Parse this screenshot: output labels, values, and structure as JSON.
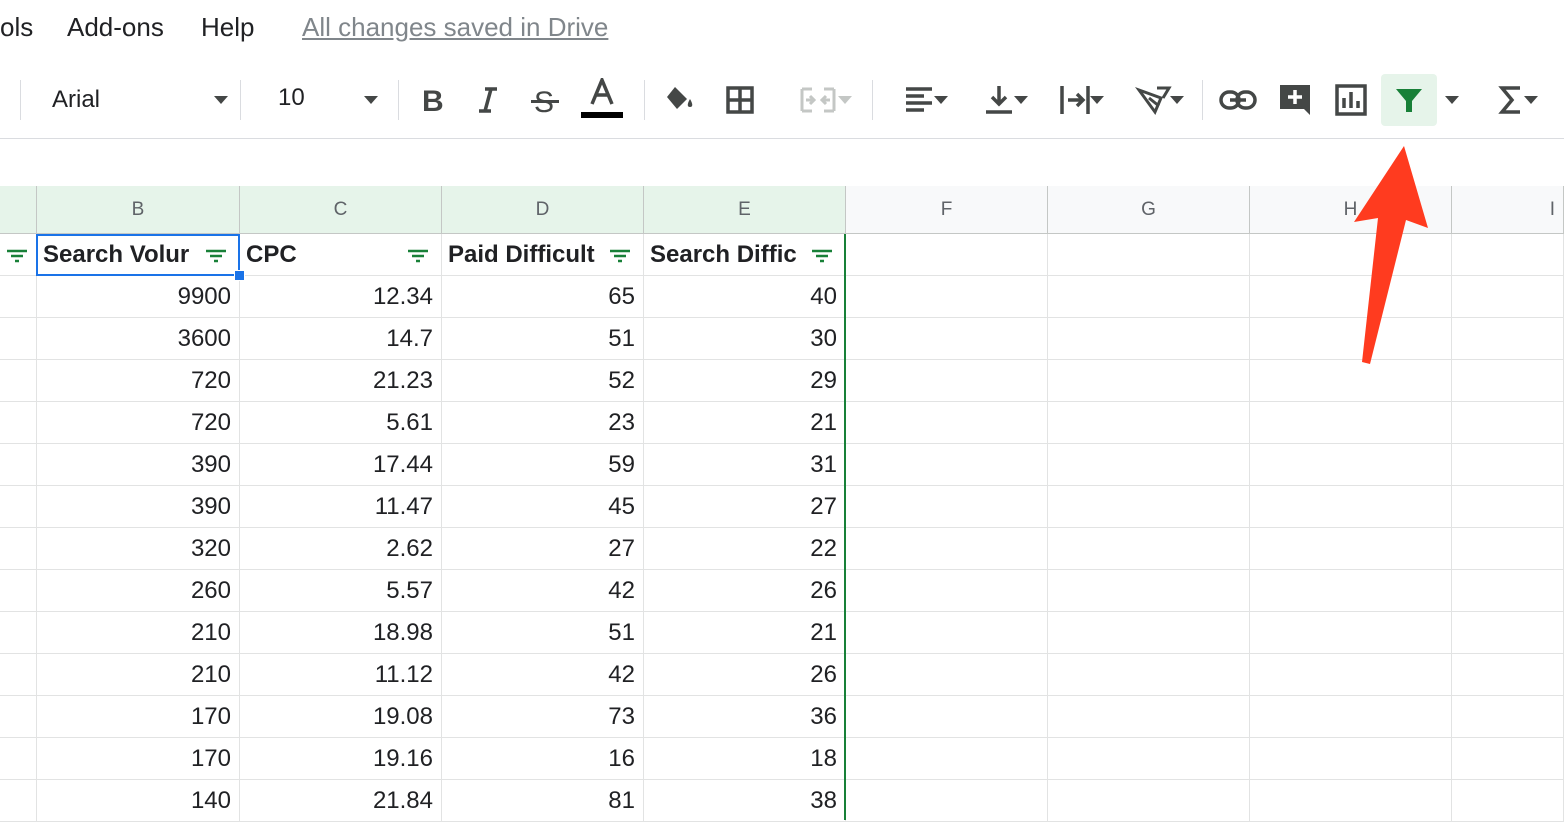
{
  "menu": {
    "items": [
      "ols",
      "Add-ons",
      "Help"
    ],
    "saved_status": "All changes saved in Drive"
  },
  "toolbar": {
    "font": "Arial",
    "font_size": "10",
    "icons": [
      "bold-icon",
      "italic-icon",
      "strikethrough-icon",
      "text-color-icon",
      "fill-color-icon",
      "borders-icon",
      "merge-cells-icon",
      "horizontal-align-icon",
      "vertical-align-icon",
      "text-wrapping-icon",
      "text-rotation-icon",
      "insert-link-icon",
      "insert-comment-icon",
      "insert-chart-icon",
      "filter-icon",
      "functions-icon"
    ],
    "accent_color": "#188038"
  },
  "grid": {
    "columns": [
      "B",
      "C",
      "D",
      "E",
      "F",
      "G",
      "H",
      "I"
    ],
    "headers": [
      "Search Volur",
      "CPC",
      "Paid Difficult",
      "Search Diffic"
    ],
    "rows": [
      [
        "9900",
        "12.34",
        "65",
        "40"
      ],
      [
        "3600",
        "14.7",
        "51",
        "30"
      ],
      [
        "720",
        "21.23",
        "52",
        "29"
      ],
      [
        "720",
        "5.61",
        "23",
        "21"
      ],
      [
        "390",
        "17.44",
        "59",
        "31"
      ],
      [
        "390",
        "11.47",
        "45",
        "27"
      ],
      [
        "320",
        "2.62",
        "27",
        "22"
      ],
      [
        "260",
        "5.57",
        "42",
        "26"
      ],
      [
        "210",
        "18.98",
        "51",
        "21"
      ],
      [
        "210",
        "11.12",
        "42",
        "26"
      ],
      [
        "170",
        "19.08",
        "73",
        "36"
      ],
      [
        "170",
        "19.16",
        "16",
        "18"
      ],
      [
        "140",
        "21.84",
        "81",
        "38"
      ]
    ]
  },
  "annotation": {
    "color": "#ff3b1f"
  }
}
